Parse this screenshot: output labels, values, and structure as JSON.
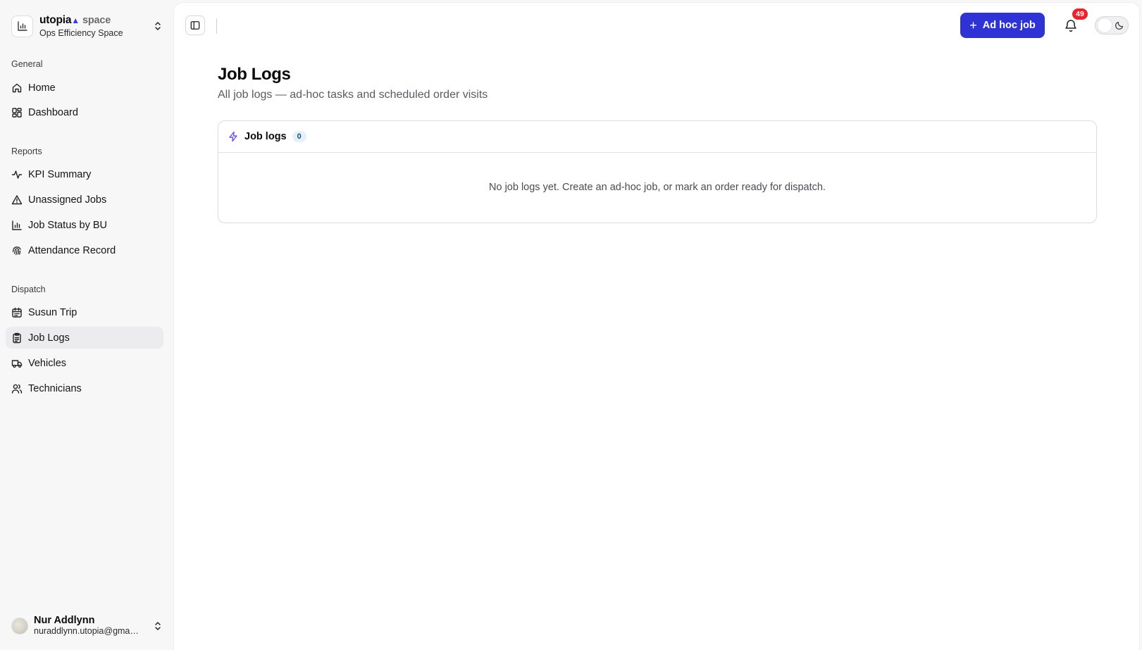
{
  "brand": {
    "name": "utopia",
    "suffix": "space",
    "workspace": "Ops Efficiency Space"
  },
  "sidebar": {
    "sections": [
      {
        "label": "General",
        "items": [
          {
            "label": "Home",
            "icon": "home-icon"
          },
          {
            "label": "Dashboard",
            "icon": "grid-icon"
          }
        ]
      },
      {
        "label": "Reports",
        "items": [
          {
            "label": "KPI Summary",
            "icon": "activity-icon"
          },
          {
            "label": "Unassigned Jobs",
            "icon": "warning-icon"
          },
          {
            "label": "Job Status by BU",
            "icon": "bar-chart-icon"
          },
          {
            "label": "Attendance Record",
            "icon": "fingerprint-icon"
          }
        ]
      },
      {
        "label": "Dispatch",
        "items": [
          {
            "label": "Susun Trip",
            "icon": "calendar-icon"
          },
          {
            "label": "Job Logs",
            "icon": "clipboard-icon",
            "active": true
          },
          {
            "label": "Vehicles",
            "icon": "truck-icon"
          },
          {
            "label": "Technicians",
            "icon": "users-icon"
          }
        ]
      }
    ]
  },
  "user": {
    "name": "Nur Addlynn",
    "email": "nuraddlynn.utopia@gmail.com"
  },
  "topbar": {
    "adhoc_label": "Ad hoc job",
    "notification_count": "49"
  },
  "page": {
    "title": "Job Logs",
    "subtitle": "All job logs — ad-hoc tasks and scheduled order visits"
  },
  "card": {
    "title": "Job logs",
    "count": "0",
    "empty_message": "No job logs yet. Create an ad-hoc job, or mark an order ready for dispatch."
  },
  "colors": {
    "accent": "#2f33d6",
    "badge": "#e5262f",
    "bolt": "#6d4df2"
  }
}
